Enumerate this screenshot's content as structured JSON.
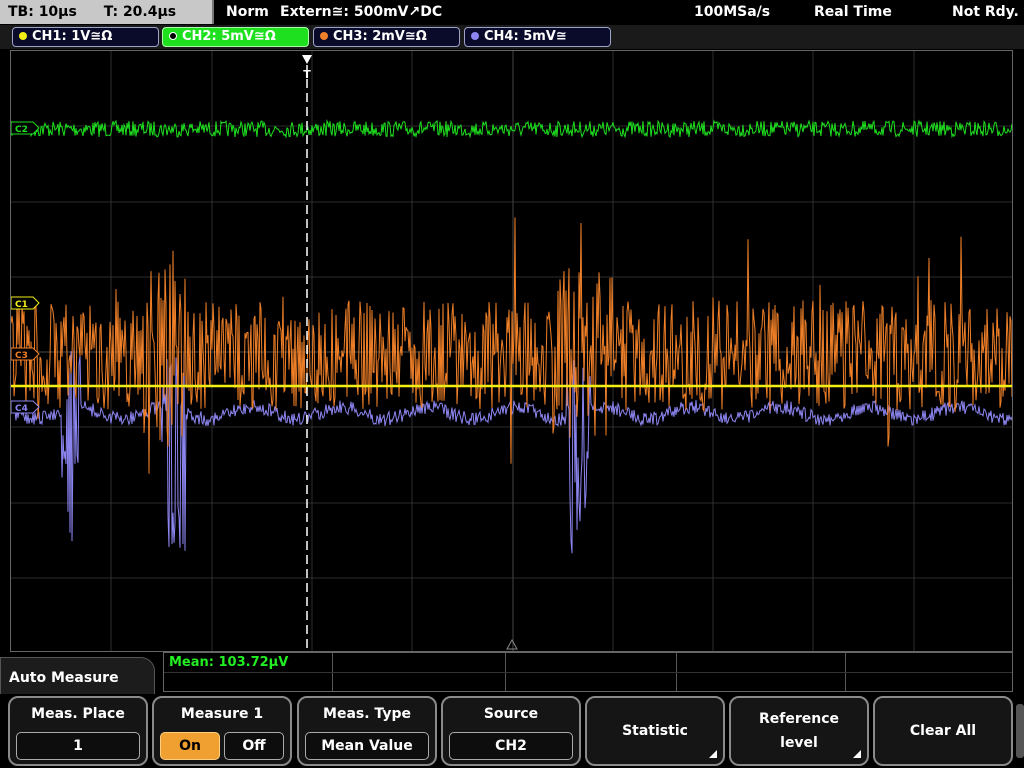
{
  "topbar": {
    "timebase": "TB: 10µs",
    "trigger_time": "T: 20.4µs",
    "mode": "Norm",
    "trigger_source": "Extern≅: 500mV↗DC",
    "sample_rate": "100MSa/s",
    "acq_mode": "Real Time",
    "status": "Not Rdy."
  },
  "channels": [
    {
      "label": "CH1: 1V≅Ω",
      "color": "#f2ee14",
      "active": false
    },
    {
      "label": "CH2: 5mV≅Ω",
      "color": "#1ee01e",
      "active": true
    },
    {
      "label": "CH3: 2mV≅Ω",
      "color": "#f08028",
      "active": false
    },
    {
      "label": "CH4: 5mV≅",
      "color": "#8d86f2",
      "active": false
    }
  ],
  "markers": {
    "ch2": "C2",
    "ch1": "C1",
    "ch3": "C3",
    "ch4": "C4",
    "trigger": "T"
  },
  "colors": {
    "ch1": "#f2ee14",
    "ch2": "#1ee01e",
    "ch3": "#f08028",
    "ch4": "#8d86f2",
    "grid": "#3a3a3a"
  },
  "measurement": {
    "readout": "Mean: 103.72µV"
  },
  "panel": {
    "title": "Auto Measure"
  },
  "softkeys": {
    "meas_place_label": "Meas. Place",
    "meas_place_value": "1",
    "measure1_label": "Measure 1",
    "on_label": "On",
    "off_label": "Off",
    "meas_type_label": "Meas. Type",
    "meas_type_value": "Mean Value",
    "source_label": "Source",
    "source_value": "CH2",
    "statistic_label": "Statistic",
    "reference_level_line1": "Reference",
    "reference_level_line2": "level",
    "clear_all_label": "Clear All"
  }
}
